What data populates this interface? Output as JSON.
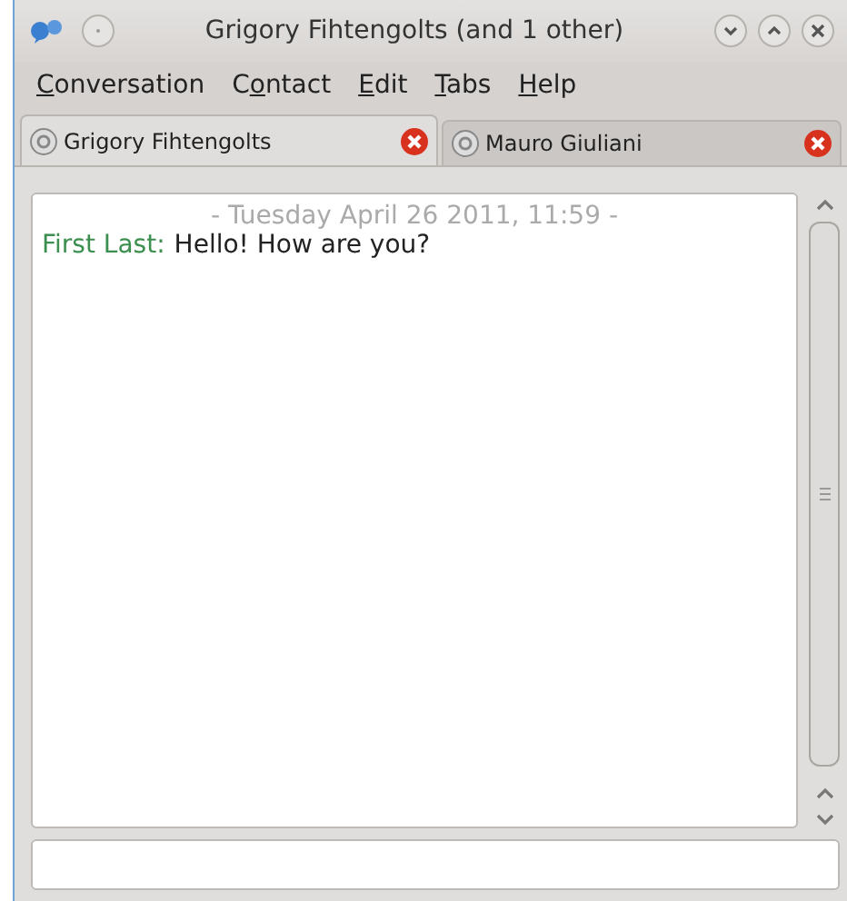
{
  "window": {
    "title": "Grigory Fihtengolts (and 1 other)"
  },
  "menu": [
    {
      "key": "C",
      "post": "onversation"
    },
    {
      "pre": "C",
      "key": "o",
      "post": "ntact"
    },
    {
      "key": "E",
      "post": "dit"
    },
    {
      "key": "T",
      "post": "abs"
    },
    {
      "key": "H",
      "post": "elp"
    }
  ],
  "tabs": [
    {
      "label": "Grigory Fihtengolts",
      "selected": true
    },
    {
      "label": "Mauro Giuliani",
      "selected": false
    }
  ],
  "chat": {
    "date": "- Tuesday April 26 2011, 11:59 -",
    "messages": [
      {
        "sender": "First Last:",
        "text": "Hello! How are you?"
      }
    ]
  }
}
